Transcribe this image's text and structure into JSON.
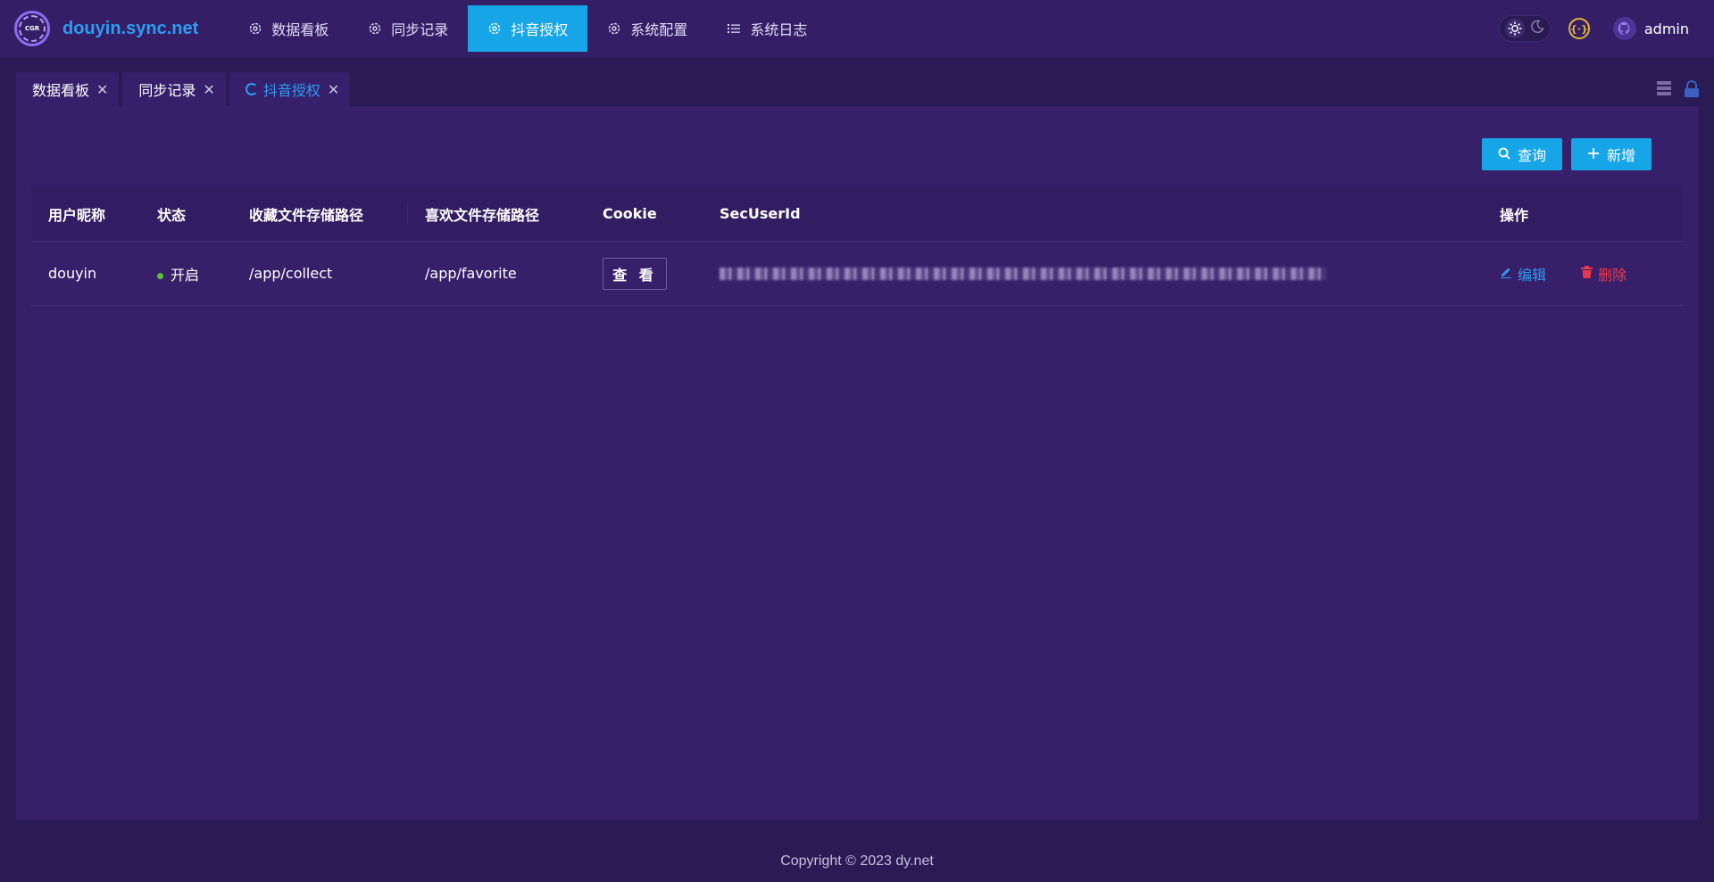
{
  "header": {
    "site_name": "douyin.sync.net",
    "logo_text": "CGR",
    "nav": [
      {
        "label": "数据看板",
        "icon": "gear-icon"
      },
      {
        "label": "同步记录",
        "icon": "gear-icon"
      },
      {
        "label": "抖音授权",
        "icon": "gear-icon",
        "active": true
      },
      {
        "label": "系统配置",
        "icon": "gear-icon"
      },
      {
        "label": "系统日志",
        "icon": "list-icon"
      }
    ],
    "username": "admin",
    "coin_symbol": "{·}"
  },
  "tabs": [
    {
      "label": "数据看板"
    },
    {
      "label": "同步记录"
    },
    {
      "label": "抖音授权",
      "active": true
    }
  ],
  "toolbar": {
    "query_label": "查询",
    "add_label": "新增"
  },
  "table": {
    "columns": [
      "用户昵称",
      "状态",
      "收藏文件存储路径",
      "喜欢文件存储路径",
      "Cookie",
      "SecUserId",
      "操作"
    ],
    "rows": [
      {
        "nickname": "douyin",
        "status": "开启",
        "collect_path": "/app/collect",
        "favorite_path": "/app/favorite",
        "cookie_button": "查 看",
        "edit_label": "编辑",
        "delete_label": "删除"
      }
    ]
  },
  "footer": {
    "copyright": "Copyright © 2023 dy.net"
  },
  "colors": {
    "accent": "#16a6e8",
    "background": "#2b1b54",
    "card": "#381f6a",
    "danger": "#e83a4c",
    "status_on": "#5bc236"
  }
}
